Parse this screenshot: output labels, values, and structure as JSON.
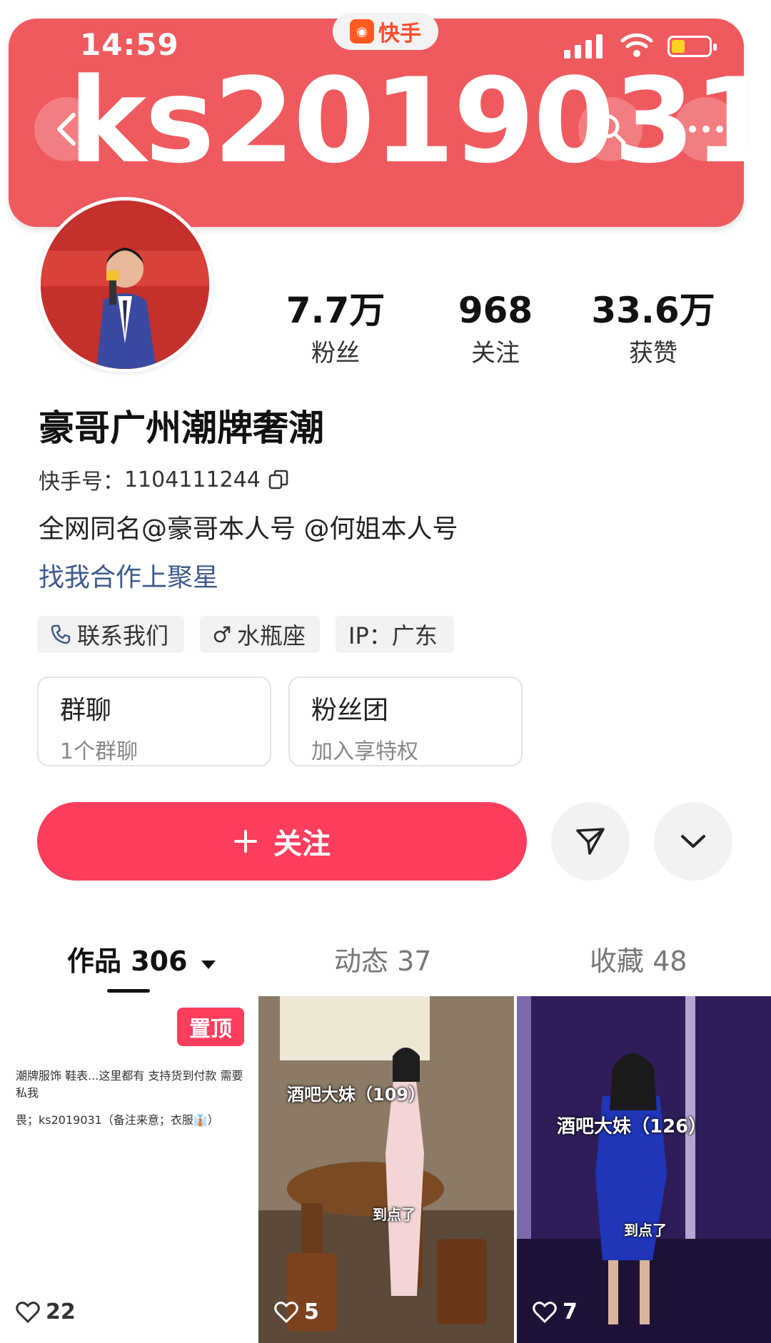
{
  "status_bar": {
    "time": "14:59",
    "app_badge": "快手"
  },
  "header": {
    "username_overlay": "ks2019031",
    "back_icon": "chevron-left-icon",
    "search_icon": "search-icon",
    "more_icon": "more-horizontal-icon"
  },
  "profile": {
    "stats": [
      {
        "value": "7.7万",
        "label": "粉丝"
      },
      {
        "value": "968",
        "label": "关注"
      },
      {
        "value": "33.6万",
        "label": "获赞"
      }
    ],
    "name": "豪哥广州潮牌奢潮",
    "kuaishou_id_label": "快手号：",
    "kuaishou_id": "1104111244",
    "bio": "全网同名@豪哥本人号 @何姐本人号",
    "collab_link": "找我合作上聚星",
    "tags": [
      {
        "icon": "phone-icon",
        "label": "联系我们"
      },
      {
        "icon": "male-icon",
        "label": "水瓶座"
      },
      {
        "label": "IP：广东"
      }
    ],
    "cards": [
      {
        "title": "群聊",
        "subtitle": "1个群聊"
      },
      {
        "title": "粉丝团",
        "subtitle": "加入享特权"
      }
    ]
  },
  "actions": {
    "follow_label": "关注",
    "follow_icon": "plus-icon",
    "share_icon": "send-icon",
    "more_icon": "chevron-down-icon"
  },
  "tabs": [
    {
      "label": "作品 306",
      "active": true
    },
    {
      "label": "动态 37",
      "active": false
    },
    {
      "label": "收藏 48",
      "active": false
    }
  ],
  "videos": [
    {
      "pinned_label": "置顶",
      "line1": "潮牌服饰 鞋表...这里都有 支持货到付款 需要私我",
      "line2": "畏；ks2019031（备注来意；衣服👔）",
      "likes": "22"
    },
    {
      "overlay_title": "酒吧大妹（109）",
      "overlay_sub": "到点了",
      "likes": "5"
    },
    {
      "overlay_title": "酒吧大妹（126）",
      "overlay_sub": "到点了",
      "likes": "7"
    }
  ],
  "colors": {
    "banner": "#ef5a5e",
    "follow": "#fd3d5d",
    "link": "#3e5a8a"
  }
}
